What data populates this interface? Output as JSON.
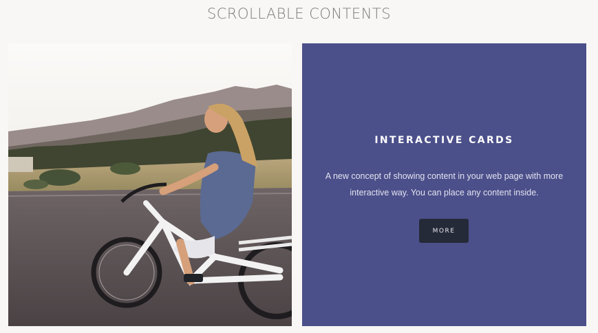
{
  "header": {
    "title": "SCROLLABLE CONTENTS"
  },
  "photo_card": {
    "image": "woman riding a white electric bicycle on a mountain road"
  },
  "info_card": {
    "title": "INTERACTIVE CARDS",
    "description": "A new concept of showing content in your web page with more interactive way. You can place any content inside.",
    "button_label": "MORE",
    "background_color": "#4b4f8a",
    "button_color": "#252a38"
  }
}
